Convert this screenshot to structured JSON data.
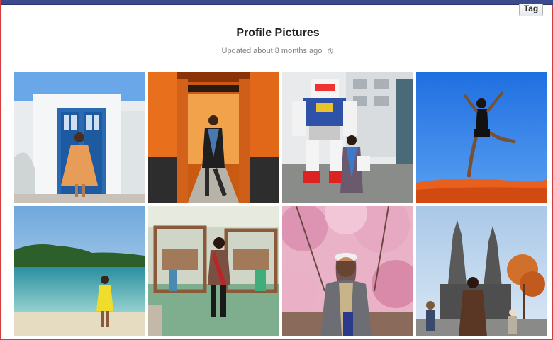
{
  "header": {
    "tag_label": "Tag",
    "title": "Profile Pictures",
    "subtitle": "Updated about 8 months ago"
  },
  "photos": [
    {
      "id": "photo-blue-door"
    },
    {
      "id": "photo-torii-gates"
    },
    {
      "id": "photo-gundam-statue"
    },
    {
      "id": "photo-jump-sky"
    },
    {
      "id": "photo-beach"
    },
    {
      "id": "photo-loom-workshop"
    },
    {
      "id": "photo-cherry-blossoms"
    },
    {
      "id": "photo-cathedral"
    }
  ]
}
